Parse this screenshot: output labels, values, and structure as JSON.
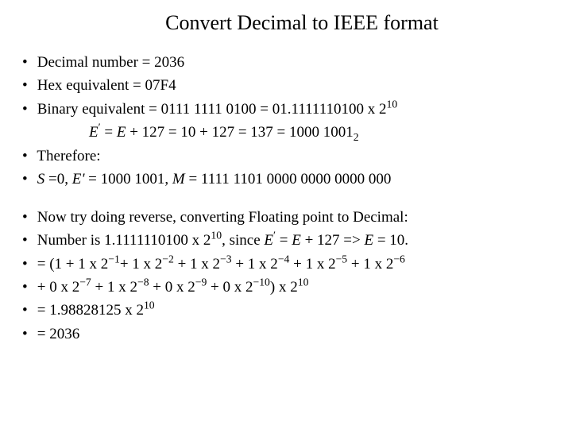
{
  "title": "Convert Decimal to IEEE format",
  "bullet": "•",
  "l1": {
    "label": "Decimal number = ",
    "val": "2036"
  },
  "l2": {
    "label": "Hex equivalent = ",
    "val": "07F4"
  },
  "l3": {
    "label": "Binary equivalent = ",
    "val": "0111 1111 0100 = 01.1111110100 x 2",
    "exp": "10"
  },
  "l4": {
    "e1": "E",
    "prime": "′",
    "eq": " = ",
    "e2": "E",
    "rest": " + 127 = 10 + 127 = 137 = 1000 1001",
    "sub": "2"
  },
  "therefore": "Therefore:",
  "l5": {
    "s": "S",
    "s_val": " =0, ",
    "ep": "E' ",
    "ep_val": "= 1000 1001, ",
    "m": "M",
    "m_val": " = 1111 1101 0000 0000 0000 000"
  },
  "reverse": "Now try doing reverse, converting Floating point to Decimal:",
  "l6": {
    "p1": "Number is 1.1111110100 x 2",
    "exp1": "10",
    "p2": ", since ",
    "e1": "E",
    "prime": "′",
    "eq": " = ",
    "e2": "E",
    "p3": " + 127 => ",
    "e3": "E",
    "p4": " = 10."
  },
  "l7a": {
    "pre": "= (1 ",
    "t1": {
      "a": "+ 1 x 2",
      "e": "−1"
    },
    "t2": {
      "a": "+ 1 x 2",
      "e": "−2"
    },
    "t3": {
      "a": " + 1 x 2",
      "e": "−3"
    },
    "t4": {
      "a": " + 1 x 2",
      "e": "−4"
    },
    "t5": {
      "a": " + 1 x 2",
      "e": "−5"
    },
    "t6": {
      "a": " + 1 x 2",
      "e": "−6"
    }
  },
  "l7b": {
    "t7": {
      "a": "+ 0 x 2",
      "e": "−7"
    },
    "t8": {
      "a": " + 1 x 2",
      "e": "−8"
    },
    "t9": {
      "a": " + 0 x 2",
      "e": "−9"
    },
    "t10": {
      "a": " + 0 x 2",
      "e": "−10"
    },
    "post": ") x 2",
    "exp": "10"
  },
  "l8": {
    "a": "= 1.98828125 x 2",
    "e": "10"
  },
  "l9": "= 2036"
}
